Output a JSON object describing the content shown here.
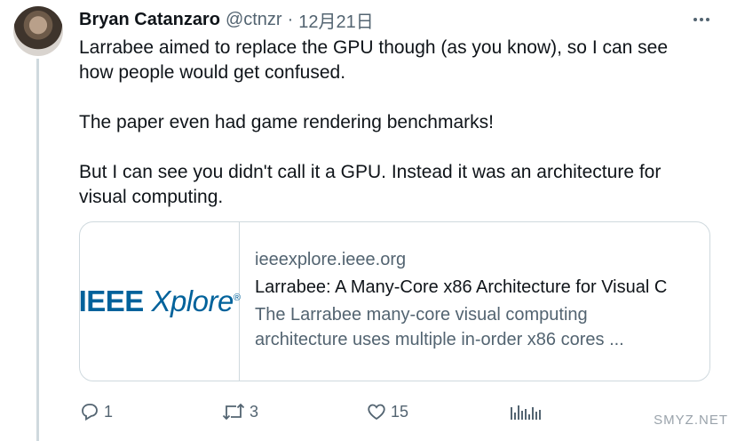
{
  "tweet": {
    "author_name": "Bryan Catanzaro",
    "handle": "@ctnzr",
    "separator": "·",
    "timestamp": "12月21日",
    "paragraphs": [
      "Larrabee aimed to replace the GPU though (as you know), so I can see how people would get confused.",
      "The paper even had game rendering benchmarks!",
      "But I can see you didn't call it a GPU. Instead it was an architecture for visual computing."
    ]
  },
  "card": {
    "logo_ieee": "IEEE",
    "logo_xplore": "Xplore",
    "logo_mark": "®",
    "domain": "ieeexplore.ieee.org",
    "title": "Larrabee: A Many-Core x86 Architecture for Visual C",
    "description": "The Larrabee many-core visual computing architecture uses multiple in-order x86 cores ..."
  },
  "actions": {
    "replies": "1",
    "retweets": "3",
    "likes": "15"
  },
  "watermark": "SMYZ.NET",
  "icons": {
    "more": "more-icon",
    "reply": "reply-icon",
    "retweet": "retweet-icon",
    "like": "heart-icon",
    "views": "views-icon"
  },
  "colors": {
    "text": "#0f1419",
    "secondary": "#536471",
    "border": "#cfd9de",
    "ieee_blue": "#00629b"
  }
}
